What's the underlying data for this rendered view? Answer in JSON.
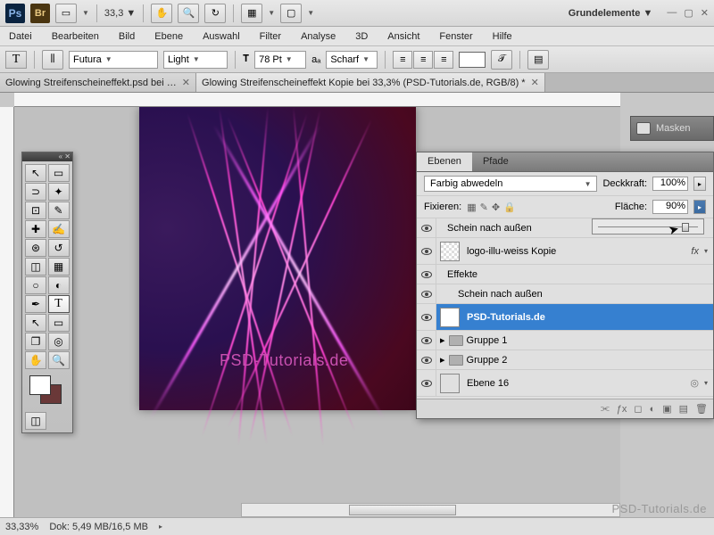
{
  "app": {
    "zoom": "33,3",
    "workspace": "Grundelemente"
  },
  "menubar": [
    "Datei",
    "Bearbeiten",
    "Bild",
    "Ebene",
    "Auswahl",
    "Filter",
    "Analyse",
    "3D",
    "Ansicht",
    "Fenster",
    "Hilfe"
  ],
  "options": {
    "font_family": "Futura",
    "font_weight": "Light",
    "font_size": "78 Pt",
    "antialias": "Scharf"
  },
  "tabs": [
    {
      "label": "Glowing Streifenscheineffekt.psd bei …",
      "active": false
    },
    {
      "label": "Glowing Streifenscheineffekt Kopie bei 33,3% (PSD-Tutorials.de, RGB/8) *",
      "active": true
    }
  ],
  "canvas": {
    "text": "PSD-Tutorials.de"
  },
  "masks_panel": {
    "label": "Masken"
  },
  "layers_panel": {
    "tabs": [
      "Ebenen",
      "Pfade"
    ],
    "blend_mode": "Farbig abwedeln",
    "opacity_label": "Deckkraft:",
    "opacity_value": "100%",
    "lock_label": "Fixieren:",
    "fill_label": "Fläche:",
    "fill_value": "90%",
    "effects_label": "Effekte",
    "outer_glow": "Schein nach außen",
    "fx_label": "fx",
    "layers": [
      {
        "name": "logo-illu-weiss Kopie"
      },
      {
        "name": "PSD-Tutorials.de",
        "selected": true
      },
      {
        "name": "Gruppe 1"
      },
      {
        "name": "Gruppe 2"
      },
      {
        "name": "Ebene 16"
      }
    ]
  },
  "status": {
    "zoom": "33,33%",
    "doc_size": "Dok: 5,49 MB/16,5 MB"
  },
  "watermark": "PSD-Tutorials.de"
}
